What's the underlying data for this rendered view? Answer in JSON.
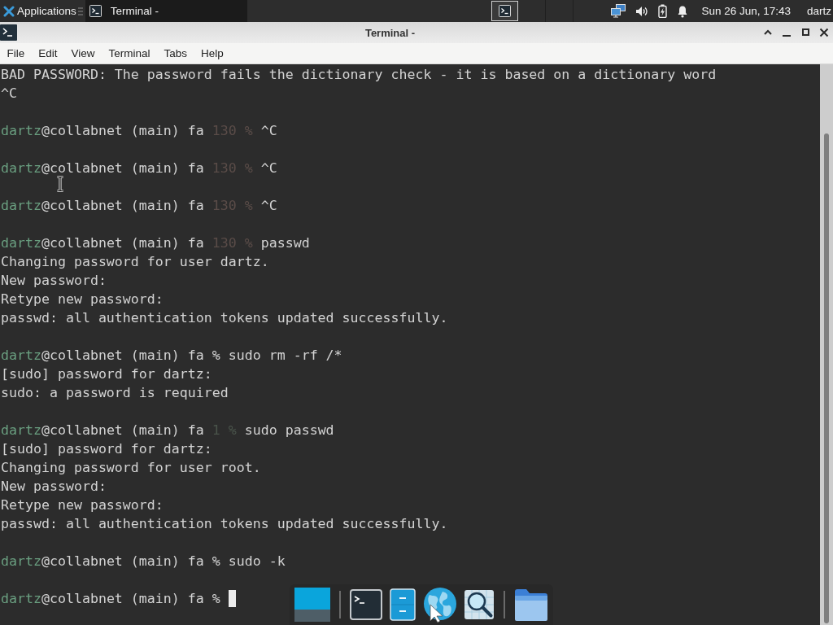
{
  "top_panel": {
    "applications": {
      "label": "Applications"
    },
    "tasks": [
      {
        "label": "Terminal -",
        "selected": true
      }
    ],
    "workspaces": [
      {
        "selected": true
      }
    ],
    "clock": "Sun 26 Jun, 17:43",
    "user": "dartz"
  },
  "window": {
    "title": "Terminal -"
  },
  "menu_bar": [
    "File",
    "Edit",
    "View",
    "Terminal",
    "Tabs",
    "Help"
  ],
  "terminal": {
    "lines": [
      {
        "kind": "output",
        "text": "BAD PASSWORD: The password fails the dictionary check - it is based on a dictionary word"
      },
      {
        "kind": "output",
        "text": "^C"
      },
      {
        "kind": "blank"
      },
      {
        "kind": "prompt",
        "user": "dartz",
        "host": "@collabnet (main) fa",
        "status": {
          "text": "130 %",
          "color": "#5a4c48"
        },
        "command": "^C",
        "cursor": false
      },
      {
        "kind": "blank"
      },
      {
        "kind": "prompt",
        "user": "dartz",
        "host": "@collabnet (main) fa",
        "status": {
          "text": "130 %",
          "color": "#5a4c48"
        },
        "command": "^C",
        "cursor": false
      },
      {
        "kind": "blank"
      },
      {
        "kind": "prompt",
        "user": "dartz",
        "host": "@collabnet (main) fa",
        "status": {
          "text": "130 %",
          "color": "#5a4c48"
        },
        "command": "^C",
        "cursor": false
      },
      {
        "kind": "blank"
      },
      {
        "kind": "prompt",
        "user": "dartz",
        "host": "@collabnet (main) fa",
        "status": {
          "text": "130 %",
          "color": "#5a4c48"
        },
        "command": "passwd",
        "cursor": false
      },
      {
        "kind": "output",
        "text": "Changing password for user dartz."
      },
      {
        "kind": "output",
        "text": "New password:"
      },
      {
        "kind": "output",
        "text": "Retype new password:"
      },
      {
        "kind": "output",
        "text": "passwd: all authentication tokens updated successfully."
      },
      {
        "kind": "blank"
      },
      {
        "kind": "prompt",
        "user": "dartz",
        "host": "@collabnet (main) fa",
        "status": {
          "text": "%",
          "color": "#d3d3d3"
        },
        "command": "sudo rm -rf /*",
        "cursor": false
      },
      {
        "kind": "output",
        "text": "[sudo] password for dartz:"
      },
      {
        "kind": "output",
        "text": "sudo: a password is required"
      },
      {
        "kind": "blank"
      },
      {
        "kind": "prompt",
        "user": "dartz",
        "host": "@collabnet (main) fa",
        "status": {
          "text": "1 %",
          "color": "#4a544b"
        },
        "command": "sudo passwd",
        "cursor": false
      },
      {
        "kind": "output",
        "text": "[sudo] password for dartz:"
      },
      {
        "kind": "output",
        "text": "Changing password for user root."
      },
      {
        "kind": "output",
        "text": "New password:"
      },
      {
        "kind": "output",
        "text": "Retype new password:"
      },
      {
        "kind": "output",
        "text": "passwd: all authentication tokens updated successfully."
      },
      {
        "kind": "blank"
      },
      {
        "kind": "prompt",
        "user": "dartz",
        "host": "@collabnet (main) fa",
        "status": {
          "text": "%",
          "color": "#d3d3d3"
        },
        "command": "sudo -k",
        "cursor": false
      },
      {
        "kind": "blank"
      },
      {
        "kind": "prompt",
        "user": "dartz",
        "host": "@collabnet (main) fa",
        "status": {
          "text": "%",
          "color": "#d3d3d3"
        },
        "cursor": true
      }
    ]
  }
}
